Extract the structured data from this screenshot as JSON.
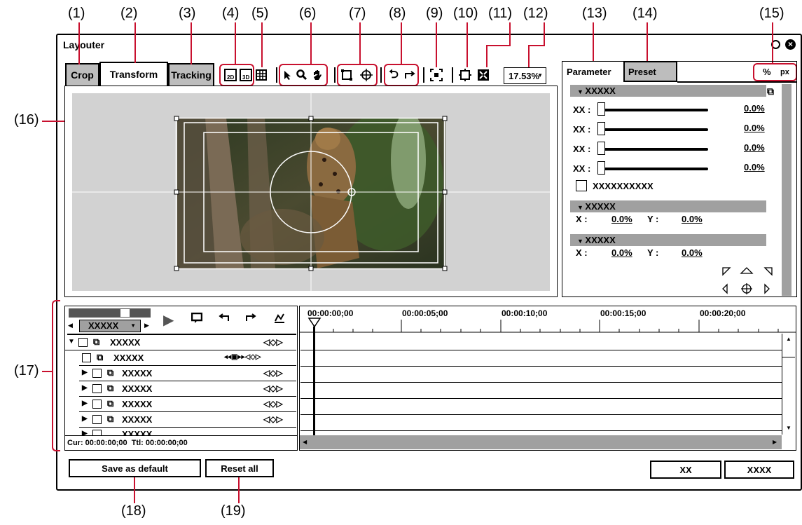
{
  "callouts": [
    "(1)",
    "(2)",
    "(3)",
    "(4)",
    "(5)",
    "(6)",
    "(7)",
    "(8)",
    "(9)",
    "(10)",
    "(11)",
    "(12)",
    "(13)",
    "(14)",
    "(15)",
    "(16)",
    "(17)",
    "(18)",
    "(19)"
  ],
  "window": {
    "title": "Layouter"
  },
  "tabs": {
    "crop": "Crop",
    "transform": "Transform",
    "tracking": "Tracking"
  },
  "toolbar": {
    "zoom": "17.53%"
  },
  "panel_tabs": {
    "parameter": "Parameter",
    "preset": "Preset"
  },
  "units": {
    "percent": "%",
    "px": "px"
  },
  "params": {
    "group1_title": "XXXXX",
    "sliders": [
      {
        "label": "XX :",
        "value": "0.0%"
      },
      {
        "label": "XX :",
        "value": "0.0%"
      },
      {
        "label": "XX :",
        "value": "0.0%"
      },
      {
        "label": "XX :",
        "value": "0.0%"
      }
    ],
    "checkbox_label": "XXXXXXXXXX",
    "group2_title": "XXXXX",
    "group2_x_label": "X :",
    "group2_x": "0.0%",
    "group2_y_label": "Y :",
    "group2_y": "0.0%",
    "group3_title": "XXXXX",
    "group3_x_label": "X :",
    "group3_x": "0.0%",
    "group3_y_label": "Y :",
    "group3_y": "0.0%"
  },
  "timeline": {
    "dropdown": "XXXXX",
    "ruler": [
      "00:00:00;00",
      "00:00:05;00",
      "00:00:10;00",
      "00:00:15;00",
      "00:00:20;00"
    ],
    "tracks": [
      "XXXXX",
      "XXXXX",
      "XXXXX",
      "XXXXX",
      "XXXXX",
      "XXXXX",
      "XXXXX"
    ],
    "status": "Cur: 00:00:00;00  Ttl: 00:00:00;00"
  },
  "buttons": {
    "save_default": "Save as default",
    "reset_all": "Reset all",
    "ok": "XX",
    "cancel": "XXXX"
  }
}
